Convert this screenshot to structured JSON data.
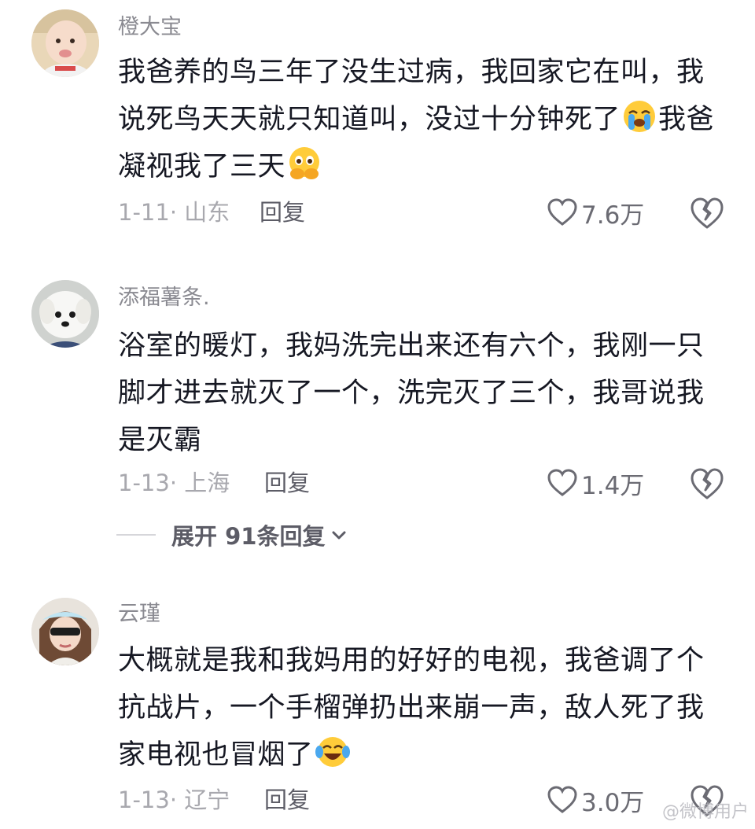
{
  "comments": [
    {
      "username": "橙大宝",
      "text_before": "我爸养的鸟三年了没生过病，我回家它在叫，我说死鸟天天就只知道叫，没过十分钟死了",
      "emoji1": "loudly-crying-face",
      "text_after": "我爸凝视我了三天",
      "emoji2": "face-holding-back-tears",
      "date_location": "1-11· 山东",
      "reply_label": "回复",
      "likes": "7.6万"
    },
    {
      "username": "添福薯条.",
      "text": "浴室的暖灯，我妈洗完出来还有六个，我刚一只脚才进去就灭了一个，洗完灭了三个，我哥说我是灭霸",
      "date_location": "1-13· 上海",
      "reply_label": "回复",
      "likes": "1.4万",
      "expand_label": "展开 91条回复"
    },
    {
      "username": "云瑾",
      "text": "大概就是我和我妈用的好好的电视，我爸调了个抗战片，一个手榴弹扔出来崩一声，敌人死了我家电视也冒烟了",
      "emoji": "face-with-tears-of-joy",
      "date_location": "1-13· 辽宁",
      "reply_label": "回复",
      "likes": "3.0万"
    }
  ],
  "watermark": "@微博用户",
  "colors": {
    "text": "#161823",
    "username": "#8a8a91",
    "meta": "#a8a8ae",
    "icon": "#6b6b73"
  }
}
